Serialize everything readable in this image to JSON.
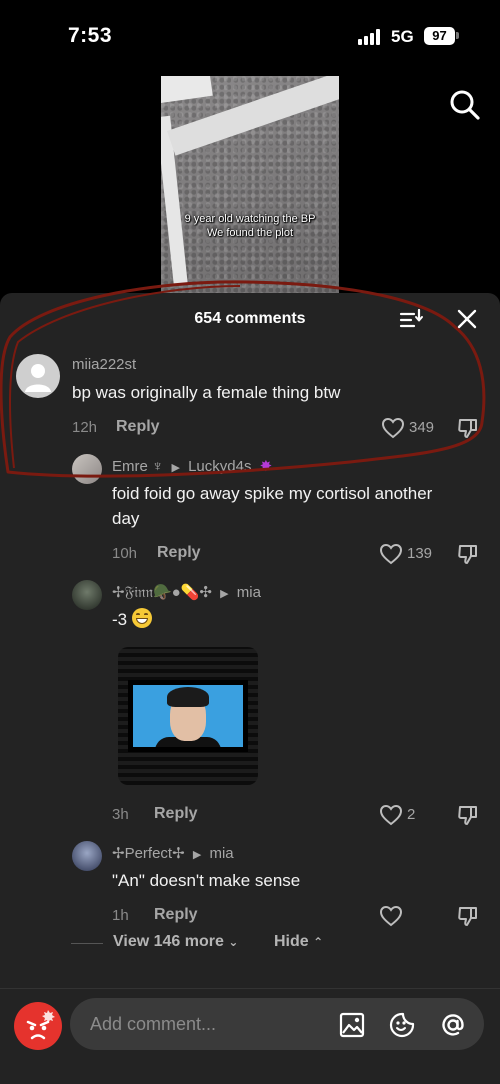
{
  "status_bar": {
    "time": "7:53",
    "network": "5G",
    "battery": "97"
  },
  "video": {
    "caption_line1": "9 year old watching the BP",
    "caption_line2": "We found the plot"
  },
  "comments_sheet": {
    "title": "654 comments",
    "comments": [
      {
        "username": "miia222st",
        "text": "bp was originally a female thing btw",
        "time": "12h",
        "reply_label": "Reply",
        "likes": "349"
      },
      {
        "username": "Emre ♆",
        "reply_to": "Luckyd4s",
        "text": "foid foid go away spike my cortisol another day",
        "time": "10h",
        "reply_label": "Reply",
        "likes": "139"
      },
      {
        "username": "✢𝔉𝔦𝔫𝔫🪖●💊✣",
        "reply_to": "mia",
        "text": "-3",
        "time": "3h",
        "reply_label": "Reply",
        "likes": "2"
      },
      {
        "username": "✢Perfect✢",
        "reply_to": "mia",
        "text": "\"An\" doesn't make sense",
        "time": "1h",
        "reply_label": "Reply",
        "likes": ""
      }
    ],
    "view_more": "View 146 more",
    "hide": "Hide"
  },
  "composer": {
    "placeholder": "Add comment..."
  },
  "colors": {
    "sheet_bg": "#232323",
    "annotation": "#7a1a10",
    "my_avatar": "#e5332d",
    "emoji_purple": "#b43ad6"
  }
}
